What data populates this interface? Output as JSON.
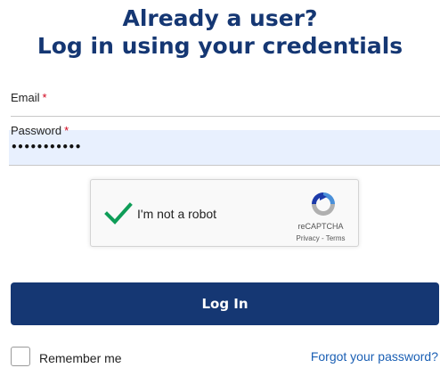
{
  "heading": {
    "line1": "Already a user?",
    "line2": "Log in using your credentials"
  },
  "form": {
    "email_label": "Email",
    "password_label": "Password",
    "required_marker": "*",
    "email_value": "",
    "password_value_masked": "•••••••••••"
  },
  "captcha": {
    "label": "I'm not a robot",
    "checked": true,
    "brand": "reCAPTCHA",
    "privacy": "Privacy",
    "separator": " - ",
    "terms": "Terms"
  },
  "login_button": "Log In",
  "remember_me": {
    "label": "Remember me",
    "checked": false
  },
  "forgot_password": "Forgot your password?",
  "colors": {
    "primary": "#153773",
    "link": "#1a5fb4",
    "required": "#d0021b",
    "autofill_bg": "#e8f0fe",
    "check_green": "#0f9d58"
  },
  "icons": {
    "captcha_check": "checkmark-icon",
    "captcha_logo": "recaptcha-logo-icon"
  }
}
